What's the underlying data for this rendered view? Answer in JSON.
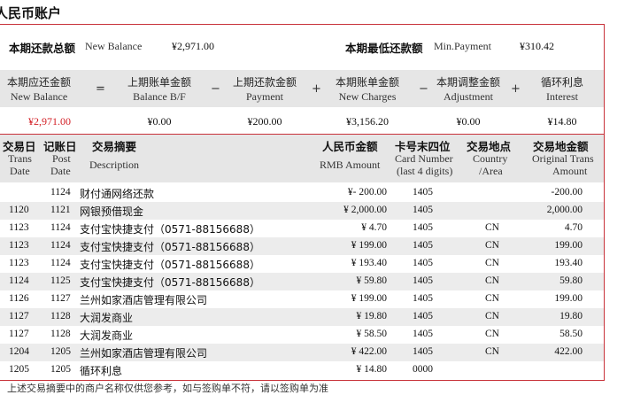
{
  "title": "人民币账户",
  "summary": {
    "new_balance_label_zh": "本期还款总额",
    "new_balance_label_en": "New Balance",
    "new_balance_value": "¥2,971.00",
    "min_payment_label_zh": "本期最低还款额",
    "min_payment_label_en": "Min.Payment",
    "min_payment_value": "¥310.42"
  },
  "calc": {
    "columns": [
      {
        "zh": "本期应还金额",
        "en": "New Balance",
        "value": "¥2,971.00",
        "highlight": true
      },
      {
        "zh": "上期账单金额",
        "en": "Balance B/F",
        "value": "¥0.00"
      },
      {
        "zh": "上期还款金额",
        "en": "Payment",
        "value": "¥200.00"
      },
      {
        "zh": "本期账单金额",
        "en": "New Charges",
        "value": "¥3,156.20"
      },
      {
        "zh": "本期调整金额",
        "en": "Adjustment",
        "value": "¥0.00"
      },
      {
        "zh": "循环利息",
        "en": "Interest",
        "value": "¥14.80"
      }
    ],
    "operators": [
      "=",
      "−",
      "+",
      "−",
      "+"
    ]
  },
  "details": {
    "headers": {
      "trans_date_zh": "交易日",
      "trans_date_en1": "Trans",
      "trans_date_en2": "Date",
      "post_date_zh": "记账日",
      "post_date_en1": "Post",
      "post_date_en2": "Date",
      "desc_zh": "交易摘要",
      "desc_en": "Description",
      "rmb_zh": "人民币金额",
      "rmb_en": "RMB Amount",
      "card_zh": "卡号末四位",
      "card_en1": "Card Number",
      "card_en2": "(last 4 digits)",
      "country_zh": "交易地点",
      "country_en1": "Country",
      "country_en2": "/Area",
      "orig_zh": "交易地金额",
      "orig_en1": "Original Trans",
      "orig_en2": "Amount"
    },
    "rows": [
      {
        "trans": "",
        "post": "1124",
        "desc": "财付通网络还款",
        "rmb": "¥- 200.00",
        "card": "1405",
        "country": "",
        "orig": "-200.00"
      },
      {
        "trans": "1120",
        "post": "1121",
        "desc": "网银预借现金",
        "rmb": "¥ 2,000.00",
        "card": "1405",
        "country": "",
        "orig": "2,000.00"
      },
      {
        "trans": "1123",
        "post": "1124",
        "desc": "支付宝快捷支付（0571-88156688）",
        "rmb": "¥ 4.70",
        "card": "1405",
        "country": "CN",
        "orig": "4.70"
      },
      {
        "trans": "1123",
        "post": "1124",
        "desc": "支付宝快捷支付（0571-88156688）",
        "rmb": "¥ 199.00",
        "card": "1405",
        "country": "CN",
        "orig": "199.00"
      },
      {
        "trans": "1123",
        "post": "1124",
        "desc": "支付宝快捷支付（0571-88156688）",
        "rmb": "¥ 193.40",
        "card": "1405",
        "country": "CN",
        "orig": "193.40"
      },
      {
        "trans": "1124",
        "post": "1125",
        "desc": "支付宝快捷支付（0571-88156688）",
        "rmb": "¥ 59.80",
        "card": "1405",
        "country": "CN",
        "orig": "59.80"
      },
      {
        "trans": "1126",
        "post": "1127",
        "desc": "兰州如家酒店管理有限公司",
        "rmb": "¥ 199.00",
        "card": "1405",
        "country": "CN",
        "orig": "199.00"
      },
      {
        "trans": "1127",
        "post": "1128",
        "desc": "大润发商业",
        "rmb": "¥ 19.80",
        "card": "1405",
        "country": "CN",
        "orig": "19.80"
      },
      {
        "trans": "1127",
        "post": "1128",
        "desc": "大润发商业",
        "rmb": "¥ 58.50",
        "card": "1405",
        "country": "CN",
        "orig": "58.50"
      },
      {
        "trans": "1204",
        "post": "1205",
        "desc": "兰州如家酒店管理有限公司",
        "rmb": "¥ 422.00",
        "card": "1405",
        "country": "CN",
        "orig": "422.00"
      },
      {
        "trans": "1205",
        "post": "1205",
        "desc": "循环利息",
        "rmb": "¥ 14.80",
        "card": "0000",
        "country": "",
        "orig": ""
      }
    ]
  },
  "footnote": "上述交易摘要中的商户名称仅供您参考，如与签购单不符，请以签购单为准"
}
